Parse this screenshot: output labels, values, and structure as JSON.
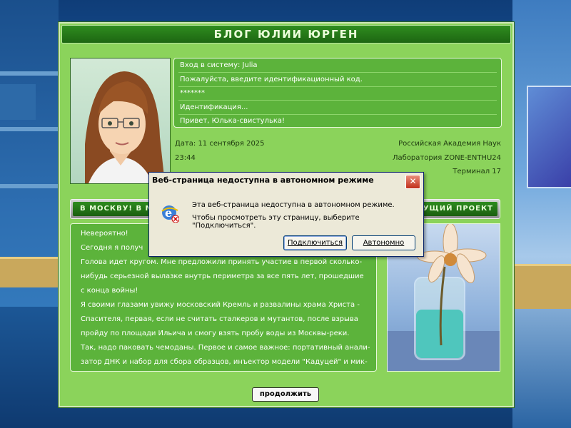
{
  "window": {
    "title": "БЛОГ ЮЛИИ ЮРГЕН"
  },
  "login": {
    "lines": [
      "Вход в систему: Julia",
      "Пожалуйста, введите идентификационный код.",
      "*******",
      "Идентификация...",
      "Привет, Юлька-свистулька!"
    ]
  },
  "info": {
    "date": "Дата: 11 сентября 2025",
    "time": "23:44",
    "org": "Российская Академия Наук",
    "lab": "Лаборатория ZONE-ENTHU24",
    "terminal": "Терминал 17"
  },
  "sections": {
    "left": "В МОСКВУ! В М",
    "right": "УЩИЙ ПРОЕКТ"
  },
  "article": {
    "lines": [
      "Невероятно!",
      "Сегодня я получ",
      "Голова идет кругом. Мне предложили принять участие в первой сколько-",
      "нибудь серьезной вылазке внутрь периметра за все пять лет, прошедшие",
      "с конца войны!",
      "Я своими глазами увижу московский Кремль и развалины храма Христа -",
      "Спасителя, первая, если не считать сталкеров и мутантов, после взрыва",
      "пройду по площади Ильича и смогу взять пробу воды из Москвы-реки.",
      "Так, надо паковать чемоданы. Первое и самое важное: портативный анали-",
      "затор ДНК и набор для сбора образцов, инъектор модели \"Кадуцей\" и мик-"
    ]
  },
  "buttons": {
    "continue": "продолжить"
  },
  "dialog": {
    "title": "Веб-страница недоступна в автономном режиме",
    "message_line1": "Эта веб-страница недоступна в автономном режиме.",
    "message_line2": "Чтобы просмотреть эту страницу, выберите \"Подключиться\".",
    "connect": "Подключиться",
    "offline": "Автономно",
    "close": "✕",
    "icon": "ie-offline-icon"
  },
  "colors": {
    "frame": "#8bd35b",
    "panel": "#5cb33b",
    "header": "#1d6612"
  }
}
